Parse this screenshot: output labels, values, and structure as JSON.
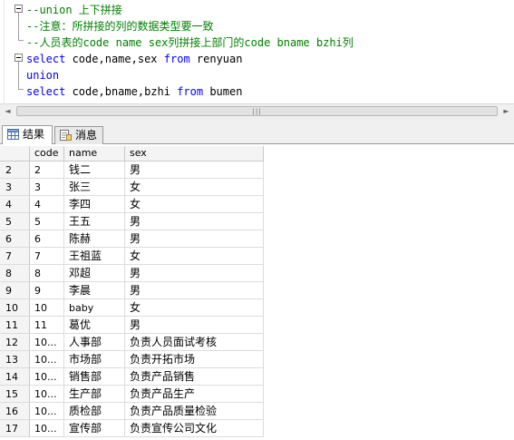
{
  "editor": {
    "lines": [
      {
        "parts": [
          {
            "t": "--union ",
            "c": "cmt",
            "mono": true
          },
          {
            "t": "上下拼接",
            "c": "cmt",
            "mono": false
          }
        ]
      },
      {
        "parts": [
          {
            "t": "--",
            "c": "cmt",
            "mono": true
          },
          {
            "t": "注意：所拼接的列的数据类型要一致",
            "c": "cmt",
            "mono": false
          }
        ]
      },
      {
        "parts": [
          {
            "t": "--",
            "c": "cmt",
            "mono": true
          },
          {
            "t": "人员表的",
            "c": "cmt",
            "mono": false
          },
          {
            "t": "code name sex",
            "c": "cmt",
            "mono": true
          },
          {
            "t": "列拼接上部门的",
            "c": "cmt",
            "mono": false
          },
          {
            "t": "code bname bzhi",
            "c": "cmt",
            "mono": true
          },
          {
            "t": "列",
            "c": "cmt",
            "mono": false
          }
        ]
      },
      {
        "parts": [
          {
            "t": "select",
            "c": "kw",
            "mono": true
          },
          {
            "t": " code",
            "c": "pl",
            "mono": true
          },
          {
            "t": ",",
            "c": "pl",
            "mono": true
          },
          {
            "t": "name",
            "c": "pl",
            "mono": true
          },
          {
            "t": ",",
            "c": "pl",
            "mono": true
          },
          {
            "t": "sex ",
            "c": "pl",
            "mono": true
          },
          {
            "t": "from",
            "c": "kw",
            "mono": true
          },
          {
            "t": " renyuan",
            "c": "pl",
            "mono": true
          }
        ]
      },
      {
        "parts": [
          {
            "t": "union",
            "c": "kw",
            "mono": true
          }
        ]
      },
      {
        "parts": [
          {
            "t": "select",
            "c": "kw",
            "mono": true
          },
          {
            "t": " code",
            "c": "pl",
            "mono": true
          },
          {
            "t": ",",
            "c": "pl",
            "mono": true
          },
          {
            "t": "bname",
            "c": "pl",
            "mono": true
          },
          {
            "t": ",",
            "c": "pl",
            "mono": true
          },
          {
            "t": "bzhi ",
            "c": "pl",
            "mono": true
          },
          {
            "t": "from",
            "c": "kw",
            "mono": true
          },
          {
            "t": " bumen",
            "c": "pl",
            "mono": true
          }
        ]
      }
    ]
  },
  "scrollbar": {
    "left_arrow": "◄",
    "right_arrow": "►",
    "grip": "|||"
  },
  "tabs": [
    {
      "label": "结果",
      "icon": "grid-icon",
      "active": true
    },
    {
      "label": "消息",
      "icon": "messages-icon",
      "active": false
    }
  ],
  "grid": {
    "columns": [
      "code",
      "name",
      "sex"
    ],
    "rows": [
      {
        "num": "2",
        "code": "2",
        "name": "钱二",
        "sex": "男"
      },
      {
        "num": "3",
        "code": "3",
        "name": "张三",
        "sex": "女"
      },
      {
        "num": "4",
        "code": "4",
        "name": "李四",
        "sex": "女"
      },
      {
        "num": "5",
        "code": "5",
        "name": "王五",
        "sex": "男"
      },
      {
        "num": "6",
        "code": "6",
        "name": "陈赫",
        "sex": "男"
      },
      {
        "num": "7",
        "code": "7",
        "name": "王祖蓝",
        "sex": "女"
      },
      {
        "num": "8",
        "code": "8",
        "name": "邓超",
        "sex": "男"
      },
      {
        "num": "9",
        "code": "9",
        "name": "李晨",
        "sex": "男"
      },
      {
        "num": "10",
        "code": "10",
        "name": "baby",
        "sex": "女"
      },
      {
        "num": "11",
        "code": "11",
        "name": "葛优",
        "sex": "男"
      },
      {
        "num": "12",
        "code": "10...",
        "name": "人事部",
        "sex": "负责人员面试考核"
      },
      {
        "num": "13",
        "code": "10...",
        "name": "市场部",
        "sex": "负责开拓市场"
      },
      {
        "num": "14",
        "code": "10...",
        "name": "销售部",
        "sex": "负责产品销售"
      },
      {
        "num": "15",
        "code": "10...",
        "name": "生产部",
        "sex": "负责产品生产"
      },
      {
        "num": "16",
        "code": "10...",
        "name": "质检部",
        "sex": "负责产品质量检验"
      },
      {
        "num": "17",
        "code": "10...",
        "name": "宣传部",
        "sex": "负责宣传公司文化"
      }
    ]
  }
}
